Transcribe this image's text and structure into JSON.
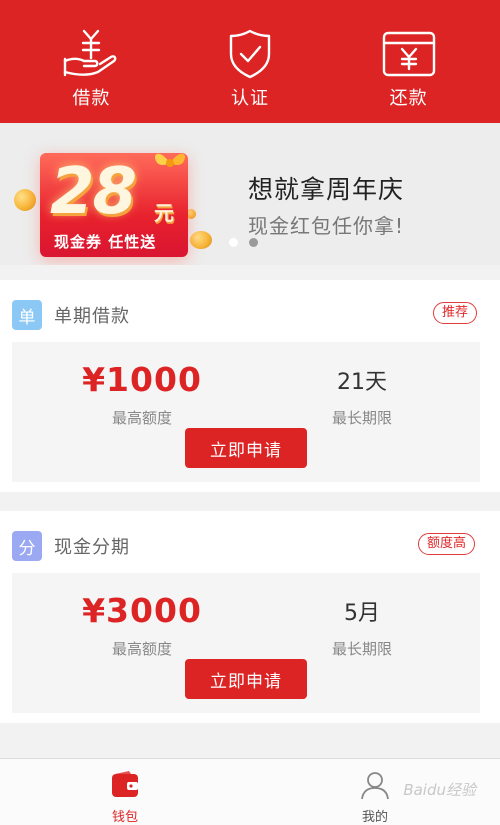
{
  "colors": {
    "brand_red": "#dd2424",
    "background": "#f2f2f2"
  },
  "topbar": {
    "items": [
      {
        "label": "借款",
        "icon": "hand-yen-icon"
      },
      {
        "label": "认证",
        "icon": "shield-check-icon"
      },
      {
        "label": "还款",
        "icon": "yen-card-icon"
      }
    ]
  },
  "banner": {
    "coupon_amount": "28",
    "coupon_unit": "元",
    "coupon_text": "现金券 任性送",
    "title": "想就拿周年庆",
    "subtitle": "现金红包任你拿!"
  },
  "loans": [
    {
      "tag": "单",
      "title": "单期借款",
      "badge": "推荐",
      "amount": "¥1000",
      "amount_label": "最高额度",
      "term": "21天",
      "term_label": "最长期限",
      "button": "立即申请"
    },
    {
      "tag": "分",
      "title": "现金分期",
      "badge": "额度高",
      "amount": "¥3000",
      "amount_label": "最高额度",
      "term": "5月",
      "term_label": "最长期限",
      "button": "立即申请"
    }
  ],
  "bottom_nav": {
    "items": [
      {
        "label": "钱包",
        "icon": "wallet-icon",
        "active": true
      },
      {
        "label": "我的",
        "icon": "user-icon",
        "active": false
      }
    ],
    "watermark": "Baidu经验"
  }
}
